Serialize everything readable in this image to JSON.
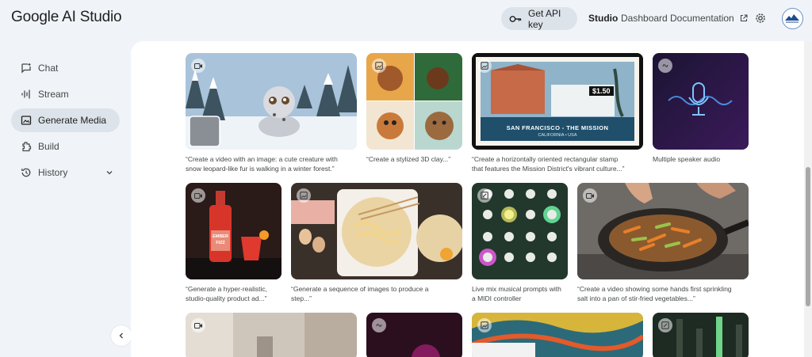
{
  "app": {
    "title": "Google AI Studio"
  },
  "header": {
    "api_key_label": "Get API key",
    "links": {
      "studio": "Studio",
      "dashboard": "Dashboard",
      "documentation": "Documentation"
    }
  },
  "sidebar": {
    "items": [
      {
        "label": "Chat",
        "icon": "chat-icon"
      },
      {
        "label": "Stream",
        "icon": "stream-icon"
      },
      {
        "label": "Generate Media",
        "icon": "generate-media-icon",
        "active": true
      },
      {
        "label": "Build",
        "icon": "build-icon"
      },
      {
        "label": "History",
        "icon": "history-icon"
      }
    ]
  },
  "gallery": {
    "cards": [
      {
        "caption_line1": "“Create a video with an image: a cute creature with",
        "caption_line2": "snow leopard-like fur is walking in a winter forest.”",
        "type": "video"
      },
      {
        "caption_line1": "“Create a stylized 3D clay...”",
        "type": "image"
      },
      {
        "caption_line1": "“Create a horizontally oriented rectangular stamp",
        "caption_line2": "that features the Mission District's vibrant culture...”",
        "type": "image",
        "stamp_price": "$1.50",
        "stamp_title": "SAN FRANCISCO - THE MISSION",
        "stamp_sub": "CALIFORNIA • USA"
      },
      {
        "caption_line1": "Multiple speaker audio",
        "type": "audio"
      },
      {
        "caption_line1": "“Generate a hyper-realistic,",
        "caption_line2": "studio-quality product ad...”",
        "type": "video",
        "bottle_label_1": "EMBER",
        "bottle_label_2": "FIZZ"
      },
      {
        "caption_line1": "“Generate a sequence of images to produce a",
        "caption_line2": "step...”",
        "type": "image"
      },
      {
        "caption_line1": "Live mix musical prompts with",
        "caption_line2": "a MIDI controller",
        "type": "app"
      },
      {
        "caption_line1": "“Create a video showing some hands first sprinkling",
        "caption_line2": "salt into a pan of stir-fried vegetables...”",
        "type": "video"
      }
    ]
  },
  "colors": {
    "background": "#f0f4f9",
    "accent": "#dde3ea",
    "surface": "#ffffff"
  }
}
